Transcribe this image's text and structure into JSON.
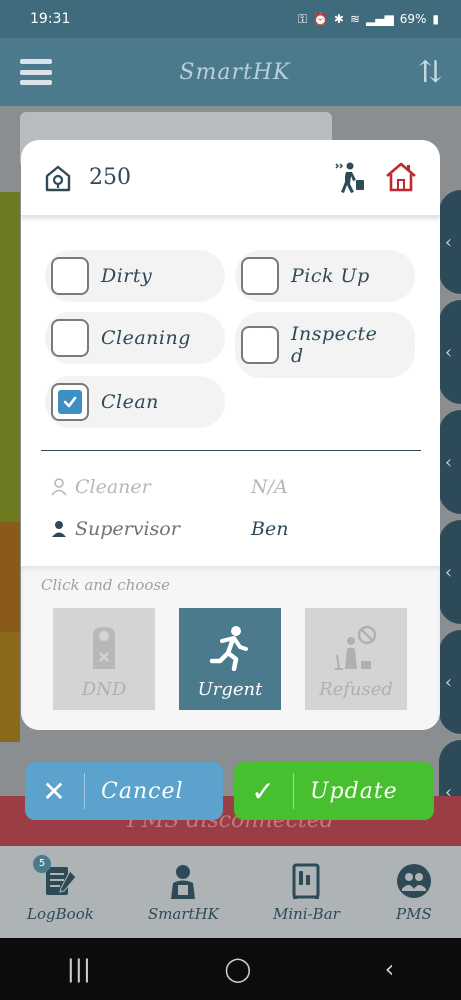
{
  "status_bar": {
    "time": "19:31",
    "battery": "69%"
  },
  "header": {
    "title": "SmartHK"
  },
  "background": {
    "pms_status": "PMS disconnected"
  },
  "modal": {
    "room_number": "250",
    "statuses": [
      {
        "label": "Dirty",
        "checked": false
      },
      {
        "label": "Pick Up",
        "checked": false
      },
      {
        "label": "Cleaning",
        "checked": false
      },
      {
        "label": "Inspecte d",
        "checked": false
      },
      {
        "label": "Clean",
        "checked": true
      }
    ],
    "cleaner": {
      "label": "Cleaner",
      "value": "N/A"
    },
    "supervisor": {
      "label": "Supervisor",
      "value": "Ben"
    },
    "choose": {
      "label": "Click and choose",
      "options": [
        {
          "label": "DND",
          "selected": false
        },
        {
          "label": "Urgent",
          "selected": true
        },
        {
          "label": "Refused",
          "selected": false
        }
      ]
    }
  },
  "actions": {
    "cancel": "Cancel",
    "update": "Update"
  },
  "bottom_nav": {
    "logbook": "LogBook",
    "logbook_badge": "5",
    "smarthk": "SmartHK",
    "minibar": "Mini-Bar",
    "pms": "PMS"
  },
  "colors": {
    "primary": "#4a7a8c",
    "cancel": "#5ba3cc",
    "update": "#48bf2e",
    "alert_red": "#c0282e"
  }
}
